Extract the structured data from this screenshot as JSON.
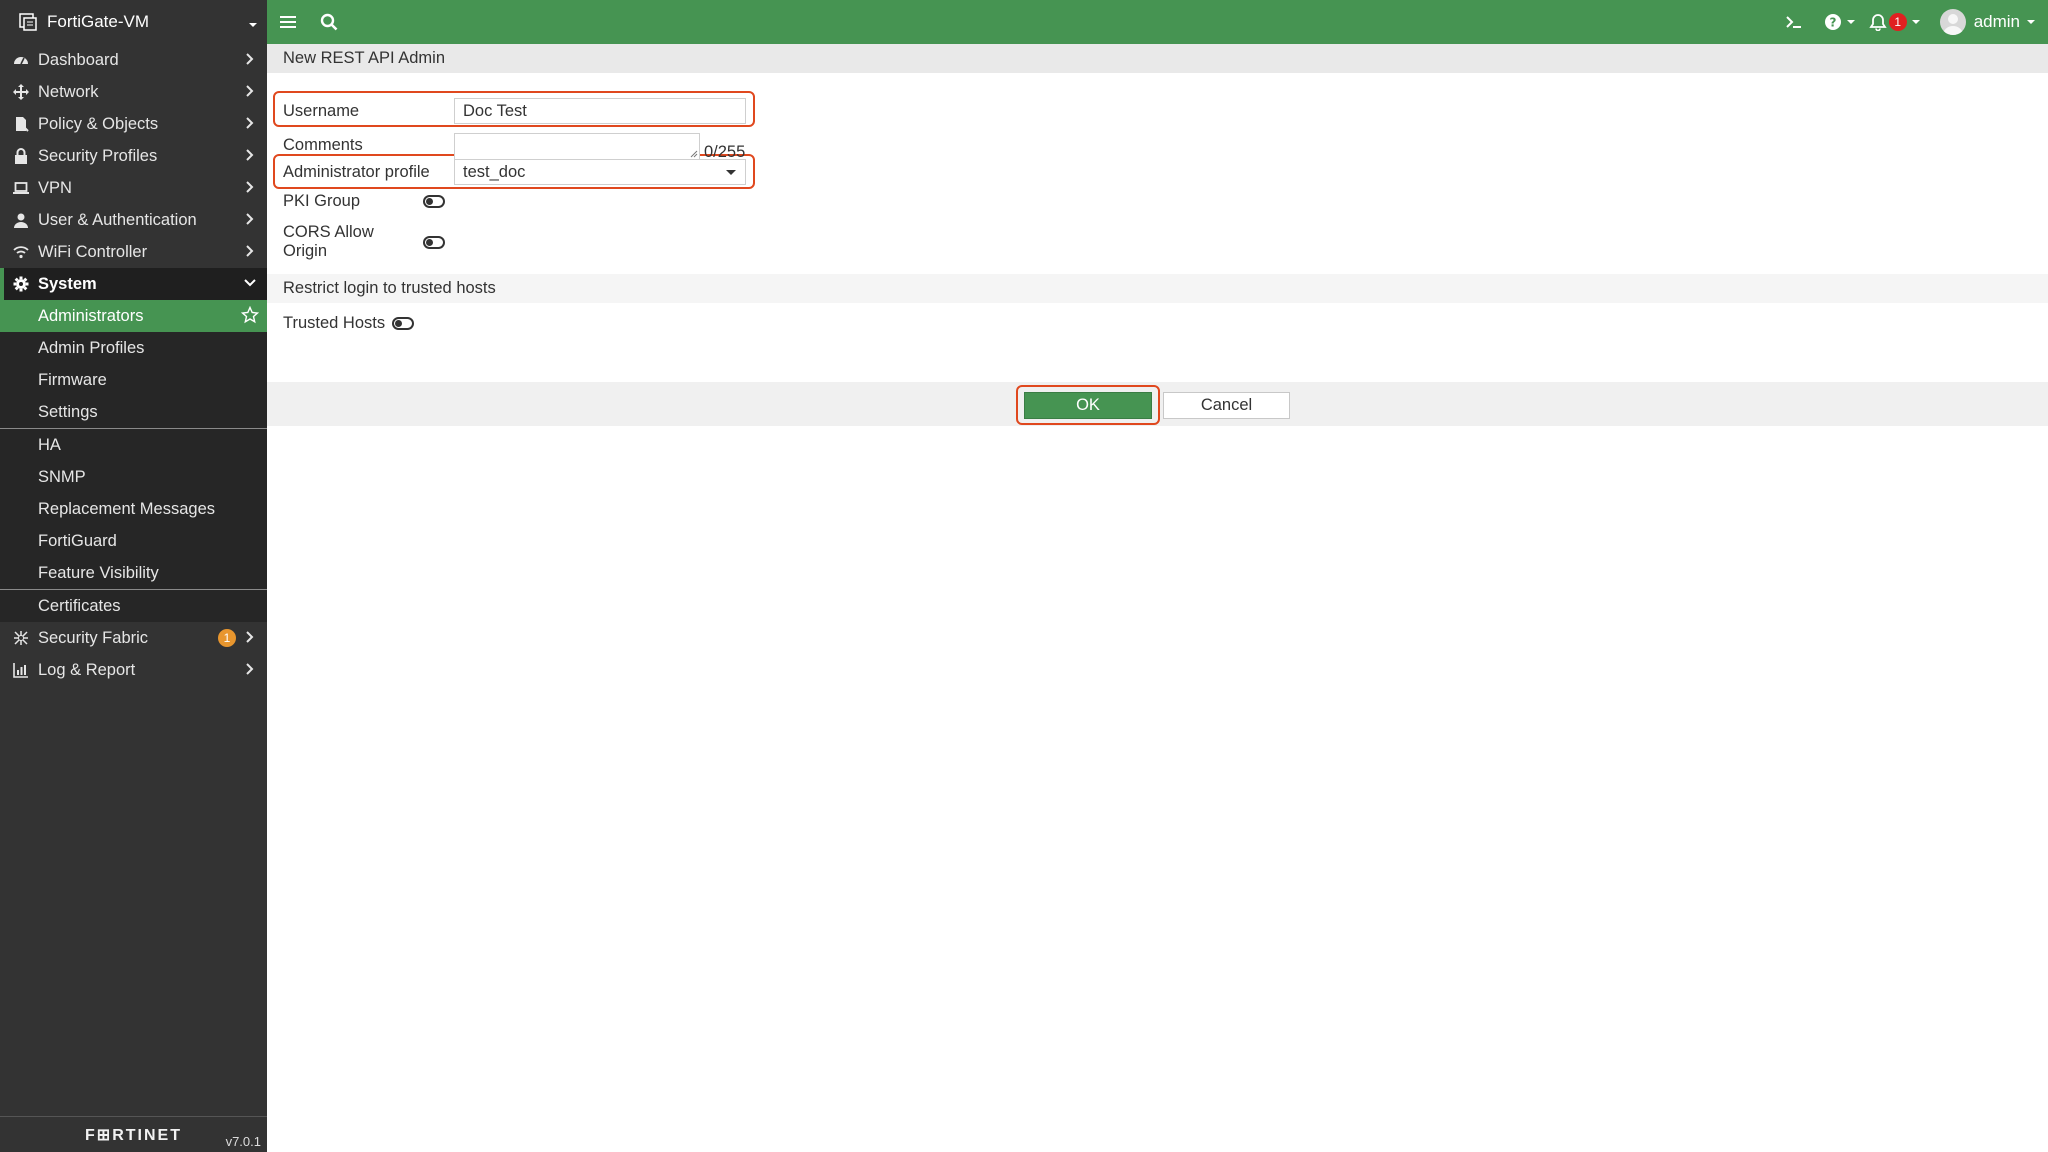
{
  "sidebar": {
    "device_name": "FortiGate-VM",
    "items": [
      {
        "label": "Dashboard"
      },
      {
        "label": "Network"
      },
      {
        "label": "Policy & Objects"
      },
      {
        "label": "Security Profiles"
      },
      {
        "label": "VPN"
      },
      {
        "label": "User & Authentication"
      },
      {
        "label": "WiFi Controller"
      },
      {
        "label": "System"
      }
    ],
    "system_subitems": [
      {
        "label": "Administrators"
      },
      {
        "label": "Admin Profiles"
      },
      {
        "label": "Firmware"
      },
      {
        "label": "Settings"
      },
      {
        "label": "HA"
      },
      {
        "label": "SNMP"
      },
      {
        "label": "Replacement Messages"
      },
      {
        "label": "FortiGuard"
      },
      {
        "label": "Feature Visibility"
      },
      {
        "label": "Certificates"
      }
    ],
    "bottom_items": [
      {
        "label": "Security Fabric",
        "badge": "1"
      },
      {
        "label": "Log & Report"
      }
    ],
    "footer_logo": "F⊞RTINET",
    "version": "v7.0.1"
  },
  "topbar": {
    "notification_count": "1",
    "user": "admin"
  },
  "form": {
    "title": "New REST API Admin",
    "username_label": "Username",
    "username_value": "Doc Test",
    "comments_label": "Comments",
    "comments_count": "0/255",
    "profile_label": "Administrator profile",
    "profile_value": "test_doc",
    "pki_label": "PKI Group",
    "cors_label": "CORS Allow Origin",
    "restrict_section": "Restrict login to trusted hosts",
    "trusted_hosts_label": "Trusted Hosts",
    "ok_label": "OK",
    "cancel_label": "Cancel"
  },
  "colors": {
    "accent_green": "#469452",
    "sidebar_bg": "#333333",
    "highlight_red": "#e0481e"
  }
}
